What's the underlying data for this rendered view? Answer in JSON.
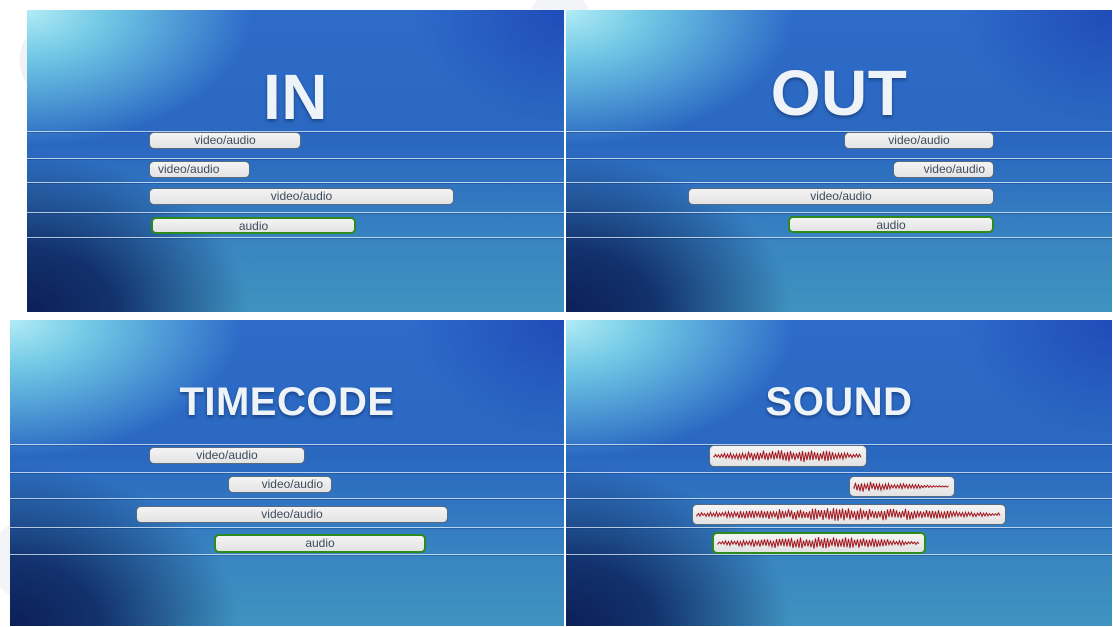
{
  "panels": [
    {
      "title": "IN",
      "clips": [
        "video/audio",
        "video/audio",
        "video/audio",
        "audio"
      ]
    },
    {
      "title": "OUT",
      "clips": [
        "video/audio",
        "video/audio",
        "video/audio",
        "audio"
      ]
    },
    {
      "title": "TIMECODE",
      "clips": [
        "video/audio",
        "video/audio",
        "video/audio",
        "audio"
      ]
    },
    {
      "title": "SOUND"
    }
  ],
  "colors": {
    "waveform": "#a3141c",
    "audio_border": "#2e8a1a",
    "clip_border": "#566a80"
  }
}
